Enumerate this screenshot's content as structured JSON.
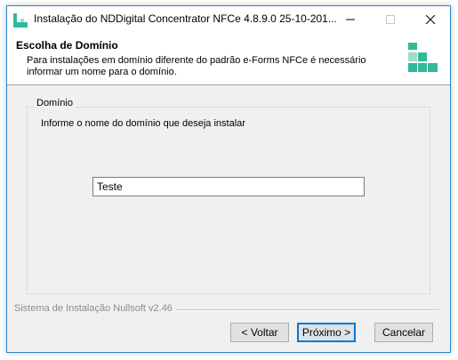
{
  "window": {
    "title": "Instalação do NDDigital Concentrator NFCe 4.8.9.0 25-10-201...",
    "minimize_icon": "minimize-icon",
    "maximize_icon": "maximize-icon",
    "close_icon": "close-icon",
    "border_color": "#2b87d3"
  },
  "header": {
    "title": "Escolha de Domínio",
    "description": "Para instalações em domínio diferente do padrão e-Forms NFCe é necessário informar um nome para o domínio.",
    "logo_color": "#2fba9a"
  },
  "domain_group": {
    "label": "Domínio",
    "instruction": "Informe o nome do domínio que deseja instalar",
    "input_value": "Teste"
  },
  "footer": {
    "branding": "Sistema de Instalação Nullsoft v2.46"
  },
  "buttons": {
    "back": "< Voltar",
    "next": "Próximo >",
    "cancel": "Cancelar"
  }
}
